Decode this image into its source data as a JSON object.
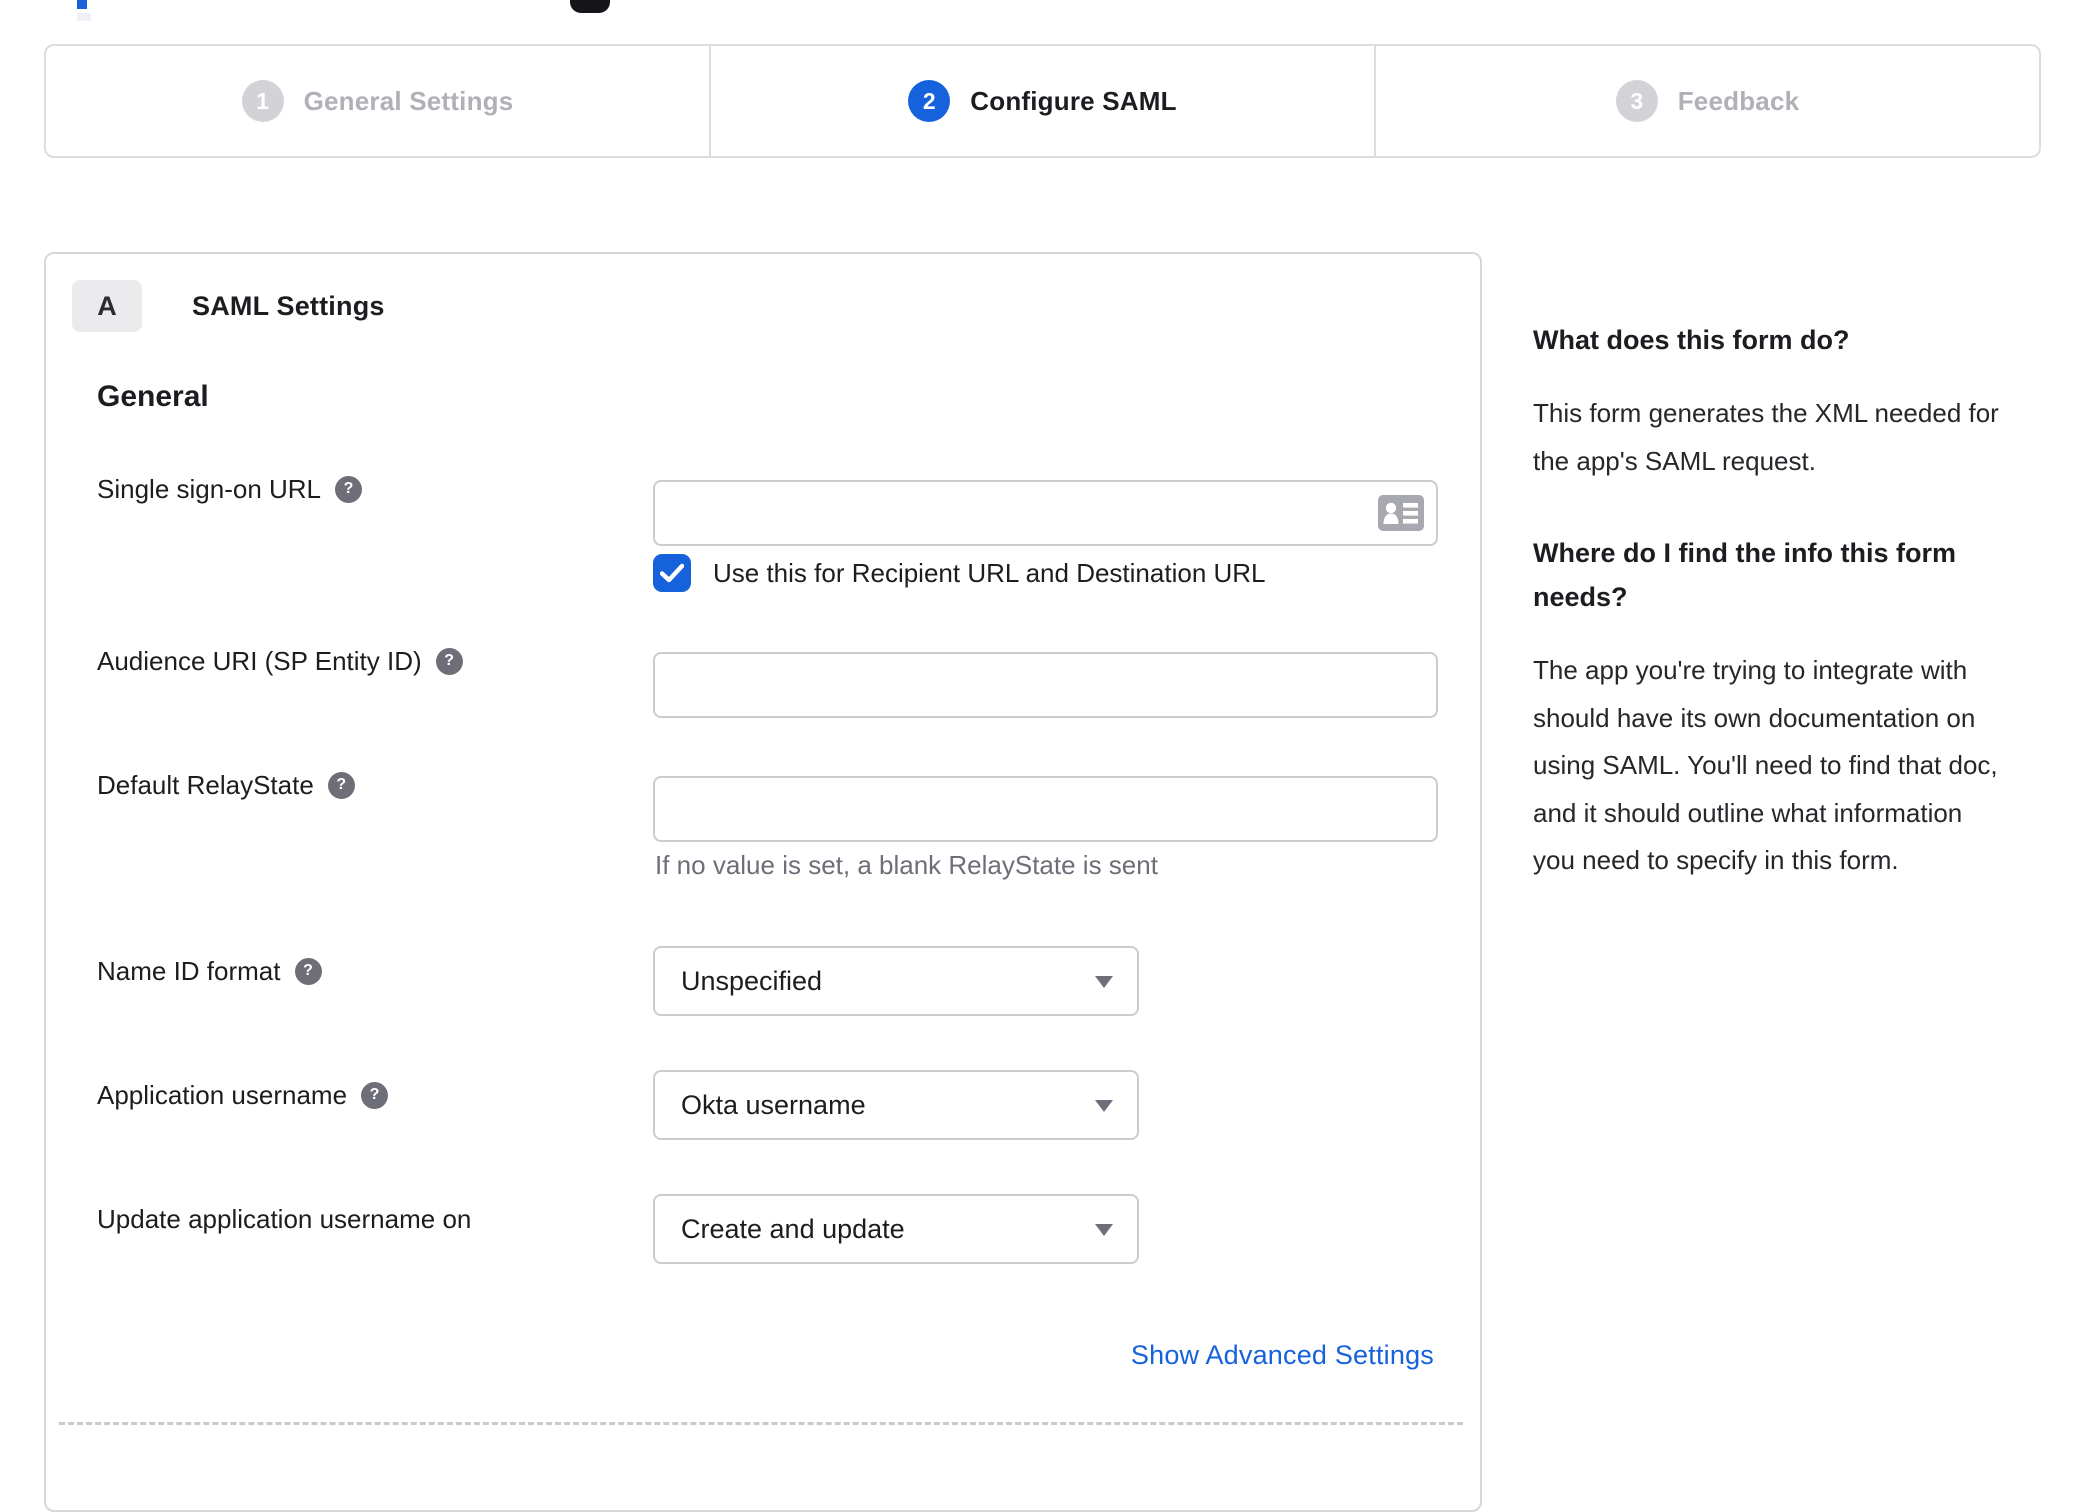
{
  "colors": {
    "accent_blue": "#1662dd",
    "inactive_gray": "#b0b0b7",
    "border_gray": "#d7d7dc",
    "helper_gray": "#6e6e78"
  },
  "stepper": {
    "steps": [
      {
        "number": "1",
        "label": "General Settings",
        "state": "inactive"
      },
      {
        "number": "2",
        "label": "Configure SAML",
        "state": "active"
      },
      {
        "number": "3",
        "label": "Feedback",
        "state": "inactive"
      }
    ]
  },
  "panel": {
    "section_letter": "A",
    "section_title": "SAML Settings",
    "group_heading": "General",
    "fields": {
      "sso_url": {
        "label": "Single sign-on URL",
        "value": ""
      },
      "sso_checkbox": {
        "label": "Use this for Recipient URL and Destination URL",
        "checked": true
      },
      "audience_uri": {
        "label": "Audience URI (SP Entity ID)",
        "value": ""
      },
      "default_relaystate": {
        "label": "Default RelayState",
        "value": "",
        "helper": "If no value is set, a blank RelayState is sent"
      },
      "name_id_format": {
        "label": "Name ID format",
        "value": "Unspecified"
      },
      "application_username": {
        "label": "Application username",
        "value": "Okta username"
      },
      "update_app_username": {
        "label": "Update application username on",
        "value": "Create and update"
      }
    },
    "advanced_link": "Show Advanced Settings"
  },
  "sidebar": {
    "heading1": "What does this form do?",
    "para1": "This form generates the XML needed for the app's SAML request.",
    "heading2": "Where do I find the info this form needs?",
    "para2": "The app you're trying to integrate with should have its own documentation on using SAML. You'll need to find that doc, and it should outline what information you need to specify in this form."
  }
}
